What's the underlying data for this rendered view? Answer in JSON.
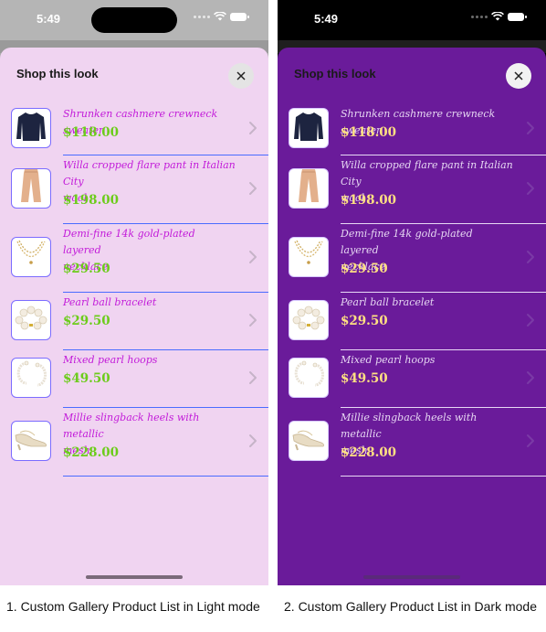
{
  "screens": [
    {
      "mode": "light",
      "status_time": "5:49",
      "title": "Shop this look",
      "caption": "1. Custom Gallery Product List in Light mode",
      "colors": {
        "sheet": "#f0d4f1",
        "name": "#c21bd9",
        "price": "#6ccc1b",
        "separator": "#4a6cff"
      }
    },
    {
      "mode": "dark",
      "status_time": "5:49",
      "title": "Shop this look",
      "caption": "2. Custom Gallery Product List in Dark mode",
      "colors": {
        "sheet": "#6a1b9a",
        "name": "#e6d6f2",
        "price": "#ffe082",
        "separator": "#e8d8f5"
      }
    }
  ],
  "products": [
    {
      "name_lines": [
        "Shrunken cashmere crewneck sweater"
      ],
      "price": "$118.00",
      "icon": "sweater-icon"
    },
    {
      "name_lines": [
        "Willa cropped flare pant in Italian City",
        "wool"
      ],
      "price": "$198.00",
      "icon": "pants-icon"
    },
    {
      "name_lines": [
        "Demi-fine 14k gold-plated layered",
        "necklace"
      ],
      "price": "$29.50",
      "icon": "necklace-icon"
    },
    {
      "name_lines": [
        "Pearl ball bracelet"
      ],
      "price": "$29.50",
      "icon": "bracelet-icon"
    },
    {
      "name_lines": [
        "Mixed pearl hoops"
      ],
      "price": "$49.50",
      "icon": "earrings-icon"
    },
    {
      "name_lines": [
        "Millie slingback heels with metallic",
        "mesh"
      ],
      "price": "$228.00",
      "icon": "heels-icon"
    }
  ]
}
